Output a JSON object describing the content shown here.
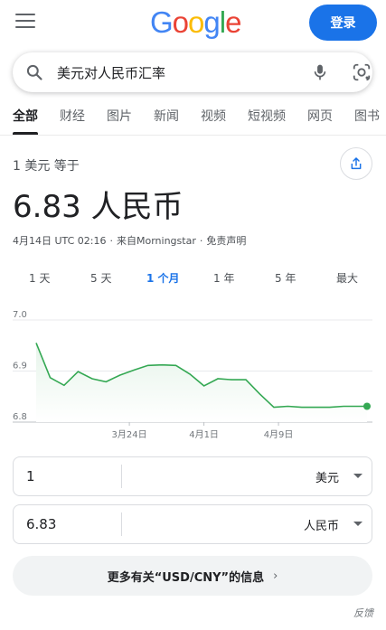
{
  "header": {
    "logo_letters": [
      {
        "char": "G",
        "color": "#4285F4"
      },
      {
        "char": "o",
        "color": "#EA4335"
      },
      {
        "char": "o",
        "color": "#FBBC05"
      },
      {
        "char": "g",
        "color": "#4285F4"
      },
      {
        "char": "l",
        "color": "#34A853"
      },
      {
        "char": "e",
        "color": "#EA4335"
      }
    ],
    "signin_label": "登录",
    "menu_icon": "hamburger-menu-icon"
  },
  "search": {
    "query": "美元对人民币汇率",
    "icons": [
      "search-icon",
      "microphone-icon",
      "google-lens-icon"
    ]
  },
  "tabs": [
    {
      "label": "全部",
      "active": true
    },
    {
      "label": "财经",
      "active": false
    },
    {
      "label": "图片",
      "active": false
    },
    {
      "label": "新闻",
      "active": false
    },
    {
      "label": "视频",
      "active": false
    },
    {
      "label": "短视频",
      "active": false
    },
    {
      "label": "网页",
      "active": false
    },
    {
      "label": "图书",
      "active": false
    }
  ],
  "rate": {
    "equals_text": "1 美元 等于",
    "value_text": "6.83 人民币",
    "timestamp": "4月14日 UTC 02:16",
    "source": "来自Morningstar",
    "disclaimer": "免责声明"
  },
  "ranges": [
    {
      "label": "1 天",
      "active": false
    },
    {
      "label": "5 天",
      "active": false
    },
    {
      "label": "1 个月",
      "active": true
    },
    {
      "label": "1 年",
      "active": false
    },
    {
      "label": "5 年",
      "active": false
    },
    {
      "label": "最大",
      "active": false
    }
  ],
  "chart_data": {
    "type": "area",
    "ylim": [
      6.8,
      7.0
    ],
    "yticks": [
      "7.0",
      "6.9",
      "6.8"
    ],
    "ytick_values": [
      7.0,
      6.9,
      6.8
    ],
    "xticks": [
      {
        "label": "3月24日",
        "x": 10
      },
      {
        "label": "4月1日",
        "x": 18
      },
      {
        "label": "4月9日",
        "x": 26
      }
    ],
    "xlim": [
      0,
      35.5
    ],
    "x": [
      0,
      1.5,
      3,
      4.5,
      6,
      7.5,
      9,
      10.5,
      12,
      13.5,
      15,
      16.5,
      18,
      19.5,
      21,
      22.5,
      24,
      25.5,
      27,
      28.5,
      30,
      31.5,
      33,
      34.5,
      35.5
    ],
    "values": [
      6.955,
      6.887,
      6.872,
      6.899,
      6.885,
      6.879,
      6.892,
      6.902,
      6.911,
      6.912,
      6.911,
      6.894,
      6.871,
      6.885,
      6.883,
      6.883,
      6.855,
      6.829,
      6.831,
      6.829,
      6.829,
      6.829,
      6.831,
      6.831,
      6.831
    ],
    "color": "#34a853"
  },
  "converter": {
    "from_value": "1",
    "from_unit": "美元",
    "to_value": "6.83",
    "to_unit": "人民币"
  },
  "more_info_label": "更多有关“USD/CNY”的信息",
  "feedback_label": "反馈"
}
